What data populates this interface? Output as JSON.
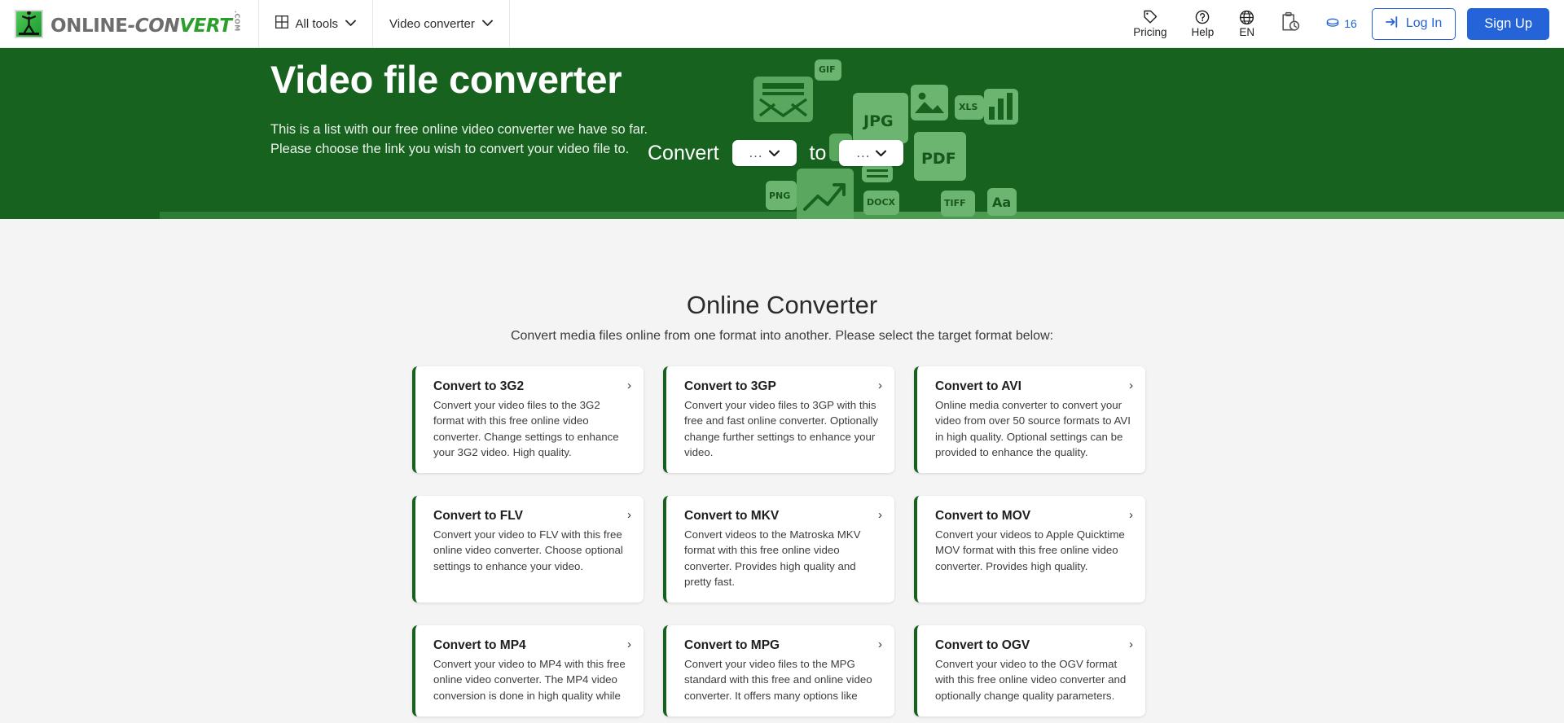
{
  "header": {
    "logo": {
      "part1": "ONLINE",
      "dash": "-",
      "part2_gray": "CON",
      "part2_green": "V",
      "part3": "ERT",
      "dotcom": ".COM"
    },
    "nav": [
      {
        "label": "All tools",
        "icon": "grid-icon",
        "chevron": "⌄"
      },
      {
        "label": "Video converter",
        "icon": "",
        "chevron": "⌄"
      }
    ],
    "right": {
      "pricing": {
        "label": "Pricing",
        "icon": "tag-icon"
      },
      "help": {
        "label": "Help",
        "icon": "question-circle-icon"
      },
      "language": {
        "label": "EN",
        "icon": "globe-icon"
      },
      "history": {
        "icon": "clipboard-clock-icon"
      },
      "credits": {
        "count": "16",
        "icon": "coin-icon"
      },
      "login": {
        "label": "Log In",
        "icon": "login-arrow-icon"
      },
      "signup": {
        "label": "Sign Up"
      }
    }
  },
  "hero": {
    "title": "Video file converter",
    "subtitle_line1": "This is a list with our free online video converter we have so far.",
    "subtitle_line2": "Please choose the link you wish to convert your video file to.",
    "convert_label": "Convert",
    "to_label": "to",
    "source_format": "...",
    "target_format": "...",
    "deco_labels": [
      "JPG",
      "GIF",
      "XLS",
      "PDF",
      "PNG",
      "DOCX",
      "TIFF",
      "Aa"
    ]
  },
  "main": {
    "title": "Online Converter",
    "subtitle": "Convert media files online from one format into another. Please select the target format below:",
    "chevron": "›",
    "cards": [
      {
        "title": "Convert to 3G2",
        "desc": "Convert your video files to the 3G2 format with this free online video converter. Change settings to enhance your 3G2 video. High quality."
      },
      {
        "title": "Convert to 3GP",
        "desc": "Convert your video files to 3GP with this free and fast online converter. Optionally change further settings to enhance your video."
      },
      {
        "title": "Convert to AVI",
        "desc": "Online media converter to convert your video from over 50 source formats to AVI in high quality. Optional settings can be provided to enhance the quality."
      },
      {
        "title": "Convert to FLV",
        "desc": "Convert your video to FLV with this free online video converter. Choose optional settings to enhance your video."
      },
      {
        "title": "Convert to MKV",
        "desc": "Convert videos to the Matroska MKV format with this free online video converter. Provides high quality and pretty fast."
      },
      {
        "title": "Convert to MOV",
        "desc": "Convert your videos to Apple Quicktime MOV format with this free online video converter. Provides high quality."
      },
      {
        "title": "Convert to MP4",
        "desc": "Convert your video to MP4 with this free online video converter. The MP4 video conversion is done in high quality while"
      },
      {
        "title": "Convert to MPG",
        "desc": "Convert your video files to the MPG standard with this free and online video converter. It offers many options like"
      },
      {
        "title": "Convert to OGV",
        "desc": "Convert your video to the OGV format with this free online video converter and optionally change quality parameters."
      }
    ]
  },
  "colors": {
    "hero_green": "#18621f",
    "card_accent": "#17601d",
    "brand_blue": "#2563d8",
    "logo_green": "#2aa02a"
  }
}
